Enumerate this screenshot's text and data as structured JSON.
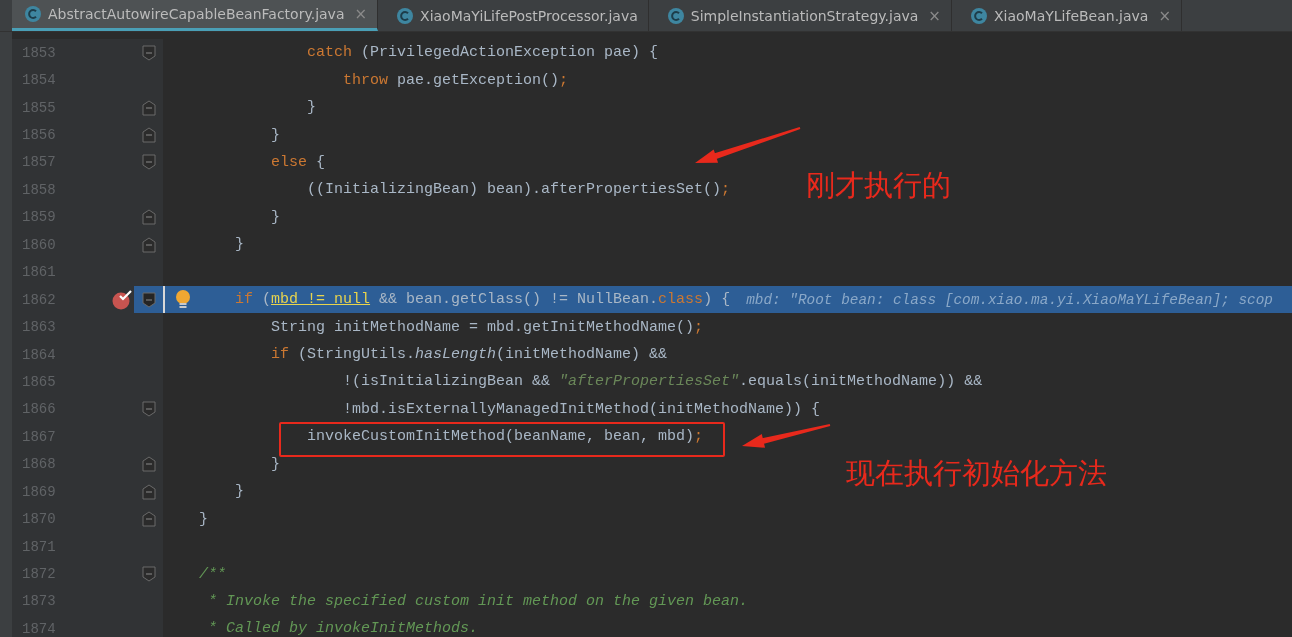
{
  "tabs": [
    {
      "label": "AbstractAutowireCapableBeanFactory.java",
      "selected": true,
      "close": "×"
    },
    {
      "label": "XiaoMaYiLifePostProcessor.java",
      "selected": false
    },
    {
      "label": "SimpleInstantiationStrategy.java",
      "selected": false,
      "close": "×"
    },
    {
      "label": "XiaoMaYLifeBean.java",
      "selected": false,
      "close": "×"
    }
  ],
  "lines": [
    {
      "number": "1853",
      "fold_open": true,
      "code": [
        {
          "text": "            catch",
          "kind": "keyword"
        },
        {
          "text": " (PrivilegedActionException pae) {",
          "kind": "plain"
        }
      ]
    },
    {
      "number": "1854",
      "code": [
        {
          "text": "                throw",
          "kind": "keyword"
        },
        {
          "text": " pae.getException()",
          "kind": "plain"
        },
        {
          "text": ";",
          "kind": "keyword"
        }
      ]
    },
    {
      "number": "1855",
      "fold_close": true,
      "code": [
        {
          "text": "            }",
          "kind": "plain"
        }
      ]
    },
    {
      "number": "1856",
      "fold_close": true,
      "code": [
        {
          "text": "        }",
          "kind": "plain"
        }
      ]
    },
    {
      "number": "1857",
      "fold_open": true,
      "code": [
        {
          "text": "        else",
          "kind": "keyword"
        },
        {
          "text": " {",
          "kind": "plain"
        }
      ]
    },
    {
      "number": "1858",
      "code": [
        {
          "text": "            ((InitializingBean) bean).afterPropertiesSet()",
          "kind": "plain"
        },
        {
          "text": ";",
          "kind": "keyword"
        }
      ]
    },
    {
      "number": "1859",
      "fold_close": true,
      "code": [
        {
          "text": "        }",
          "kind": "plain"
        }
      ]
    },
    {
      "number": "1860",
      "fold_close": true,
      "code": [
        {
          "text": "    }",
          "kind": "plain"
        }
      ]
    },
    {
      "number": "1861"
    },
    {
      "number": "1862",
      "fold_open": true,
      "current": true,
      "breakpoint": true,
      "bulb": true,
      "code": [
        {
          "text": "    if",
          "kind": "keyword"
        },
        {
          "text": " (",
          "kind": "plain"
        },
        {
          "text": "mbd != null",
          "kind": "usage"
        },
        {
          "text": " && bean.getClass() != NullBean.",
          "kind": "plain"
        },
        {
          "text": "class",
          "kind": "keyword"
        },
        {
          "text": ") {",
          "kind": "plain"
        }
      ],
      "hint": "mbd: \"Root bean: class [com.xiao.ma.yi.XiaoMaYLifeBean]; scop"
    },
    {
      "number": "1863",
      "code": [
        {
          "text": "        String initMethodName = mbd.getInitMethodName()",
          "kind": "plain"
        },
        {
          "text": ";",
          "kind": "keyword"
        }
      ]
    },
    {
      "number": "1864",
      "code": [
        {
          "text": "        if",
          "kind": "keyword"
        },
        {
          "text": " (StringUtils.",
          "kind": "plain"
        },
        {
          "text": "hasLength",
          "kind": "static"
        },
        {
          "text": "(initMethodName) &&",
          "kind": "plain"
        }
      ]
    },
    {
      "number": "1865",
      "code": [
        {
          "text": "                !(isInitializingBean && ",
          "kind": "plain"
        },
        {
          "text": "\"afterPropertiesSet\"",
          "kind": "string"
        },
        {
          "text": ".equals(initMethodName)) &&",
          "kind": "plain"
        }
      ]
    },
    {
      "number": "1866",
      "fold_open": true,
      "code": [
        {
          "text": "                !mbd.isExternallyManagedInitMethod(initMethodName)) {",
          "kind": "plain"
        }
      ]
    },
    {
      "number": "1867",
      "boxed": true,
      "code": [
        {
          "text": "            invokeCustomInitMethod(beanName, bean, mbd)",
          "kind": "plain"
        },
        {
          "text": ";",
          "kind": "keyword"
        }
      ]
    },
    {
      "number": "1868",
      "fold_close": true,
      "code": [
        {
          "text": "        }",
          "kind": "plain"
        }
      ]
    },
    {
      "number": "1869",
      "fold_close": true,
      "code": [
        {
          "text": "    }",
          "kind": "plain"
        }
      ]
    },
    {
      "number": "1870",
      "fold_close": true,
      "code": [
        {
          "text": "}",
          "kind": "plain"
        }
      ]
    },
    {
      "number": "1871"
    },
    {
      "number": "1872",
      "fold_open": true,
      "code": [
        {
          "text": "/**",
          "kind": "comment"
        }
      ]
    },
    {
      "number": "1873",
      "code": [
        {
          "text": " * Invoke the specified custom init method on the given bean.",
          "kind": "comment"
        }
      ]
    },
    {
      "number": "1874",
      "code": [
        {
          "text": " * Called by invokeInitMethods.",
          "kind": "comment"
        }
      ]
    }
  ],
  "annotations": [
    {
      "kind": "arrow",
      "text": "刚才执行的"
    },
    {
      "kind": "arrow",
      "text": "现在执行初始化方法"
    }
  ]
}
